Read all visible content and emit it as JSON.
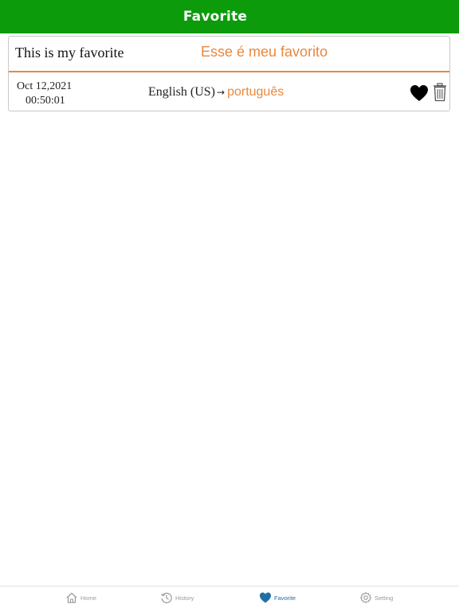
{
  "header": {
    "title": "Favorite"
  },
  "favorites": [
    {
      "source_text": "This is my favorite",
      "translated_text": "Esse é meu favorito",
      "date": "Oct 12,2021",
      "time": "00:50:01",
      "from_language": "English (US)",
      "arrow": "→",
      "to_language": "português",
      "favorited": true,
      "icons": [
        "heart-icon",
        "trash-icon"
      ]
    }
  ],
  "tabbar": {
    "tabs": [
      {
        "label": "Home",
        "icon": "home-icon",
        "active": false
      },
      {
        "label": "History",
        "icon": "history-icon",
        "active": false
      },
      {
        "label": "Favorite",
        "icon": "heart-icon",
        "active": true
      },
      {
        "label": "Setting",
        "icon": "gear-icon",
        "active": false
      }
    ]
  },
  "colors": {
    "header_bg": "#0b9b0b",
    "accent_orange": "#e8883d",
    "active_tab": "#1f6fa8",
    "inactive_tab": "#9a9a9a"
  }
}
